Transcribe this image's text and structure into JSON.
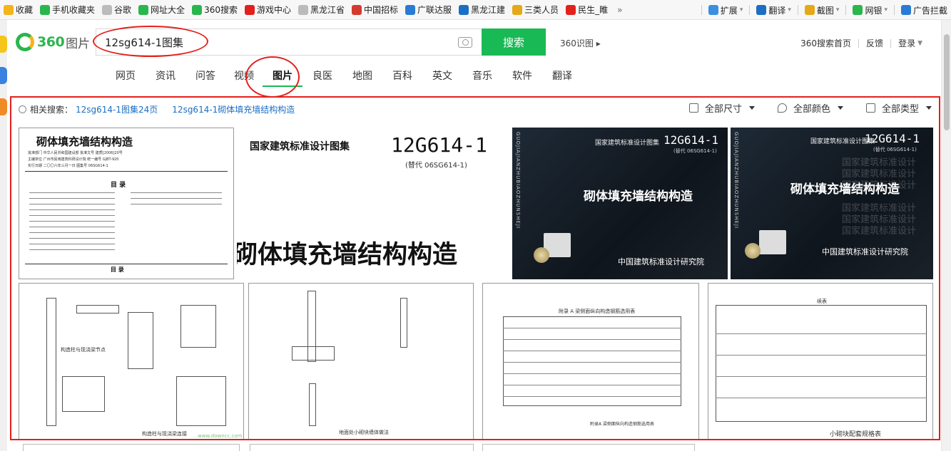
{
  "bookmarks": {
    "items": [
      {
        "label": "收藏",
        "icon": "star-icon",
        "color": "#f5b41b"
      },
      {
        "label": "手机收藏夹",
        "icon": "phone-icon",
        "color": "#2ab64d"
      },
      {
        "label": "谷歌",
        "icon": "page-icon",
        "color": "#bbbbbb"
      },
      {
        "label": "网址大全",
        "icon": "globe-icon",
        "color": "#2ab64d"
      },
      {
        "label": "360搜索",
        "icon": "search360-icon",
        "color": "#2ab64d"
      },
      {
        "label": "游戏中心",
        "icon": "game-icon",
        "color": "#e3201b"
      },
      {
        "label": "黑龙江省",
        "icon": "page-icon",
        "color": "#bbbbbb"
      },
      {
        "label": "中国招标",
        "icon": "bid-icon",
        "color": "#d43a2f"
      },
      {
        "label": "广联达服",
        "icon": "cloud-icon",
        "color": "#2a7bd4"
      },
      {
        "label": "黑龙江建",
        "icon": "e-icon",
        "color": "#1a6ec4"
      },
      {
        "label": "三类人员",
        "icon": "study-icon",
        "color": "#e6a817"
      },
      {
        "label": "民生_睢",
        "icon": "weibo-icon",
        "color": "#e3201b"
      }
    ],
    "more": "»",
    "right": [
      {
        "label": "扩展",
        "icon": "extension-icon",
        "color": "#3b8fe0"
      },
      {
        "label": "翻译",
        "icon": "translate-icon",
        "color": "#1a6ec4"
      },
      {
        "label": "截图",
        "icon": "scissors-icon",
        "color": "#e6a817"
      },
      {
        "label": "网银",
        "icon": "bank-icon",
        "color": "#2ab64d"
      },
      {
        "label": "广告拦截",
        "icon": "adblock-icon",
        "color": "#2a7bd4"
      }
    ]
  },
  "header": {
    "logo_text": "360",
    "logo_sub": "图片",
    "search_value": "12sg614-1图集",
    "search_button": "搜索",
    "shitu": "360识图 ▸",
    "links": [
      "360搜索首页",
      "反馈",
      "登录"
    ]
  },
  "tabs": [
    {
      "label": "网页",
      "active": false
    },
    {
      "label": "资讯",
      "active": false
    },
    {
      "label": "问答",
      "active": false
    },
    {
      "label": "视频",
      "active": false
    },
    {
      "label": "图片",
      "active": true
    },
    {
      "label": "良医",
      "active": false
    },
    {
      "label": "地图",
      "active": false
    },
    {
      "label": "百科",
      "active": false
    },
    {
      "label": "英文",
      "active": false
    },
    {
      "label": "音乐",
      "active": false
    },
    {
      "label": "软件",
      "active": false
    },
    {
      "label": "翻译",
      "active": false
    }
  ],
  "results": {
    "related_label": "相关搜索：",
    "related": [
      "12sg614-1图集24页",
      "12sg614-1砌体填充墙结构构造"
    ],
    "filters": [
      "全部尺寸",
      "全部颜色",
      "全部类型"
    ],
    "img1": {
      "title": "砌体填充墙结构构造",
      "toc_title": "目  录",
      "footer": "目  录",
      "meta": [
        "批准部门 中华人民共和国建设部 批准文号 建质[2006]20号",
        "主编单位 广州市民用建筑科研设计院 统一编号 GJBT-920",
        "实行日期 二〇〇六年三月一日 图集号 06SG614-1"
      ]
    },
    "img2": {
      "header": "国家建筑标准设计图集",
      "code": "12G614-1",
      "sub": "(替代 06SG614-1)",
      "main": "砌体填充墙结构构造"
    },
    "img3": {
      "header": "国家建筑标准设计图集",
      "code": "12G614-1",
      "sub": "(替代 06SG614-1)",
      "main": "砌体填充墙结构构造",
      "org": "中国建筑标准设计研究院",
      "spine": "GUOJIAJIANZHUBIAOZHUNSHEJI"
    },
    "img4": {
      "header": "国家建筑标准设计图集",
      "code": "12G614-1",
      "sub": "(替代 06SG614-1)",
      "main": "砌体填充墙结构构造",
      "org": "中国建筑标准设计研究院",
      "watermark": "国家建筑标准设计",
      "spine": "GUOJIAJIANZHUBIAOZHUNSHEJI"
    },
    "img5": {
      "caption": "构造柱与现浇梁连接",
      "node": "构造柱与现浇梁节点",
      "site": "www.downcc.com"
    },
    "img6": {
      "caption": "地面处小砌块墙体做法"
    },
    "img7": {
      "caption": "附录A 梁侧面纵向构造钢筋选用表",
      "table_title": "附录 A  梁侧面纵向构造钢筋选用表"
    },
    "img8": {
      "caption": "小砌块配套规格表",
      "table_title": "续表"
    }
  }
}
